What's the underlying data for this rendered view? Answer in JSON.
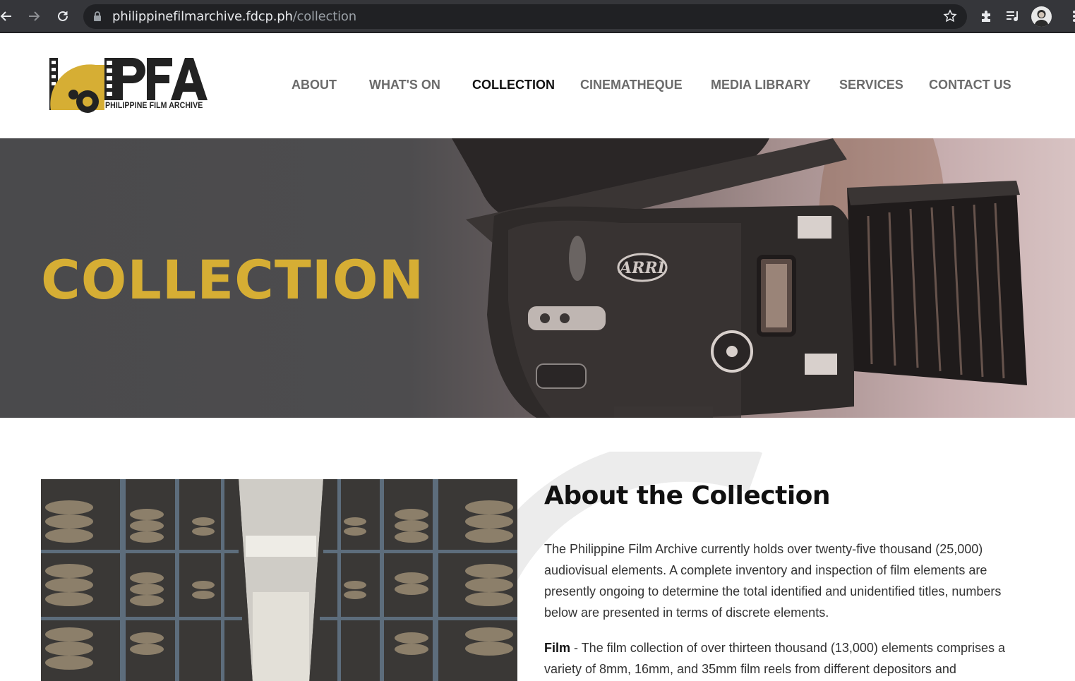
{
  "browser": {
    "url_host": "philippinefilmarchive.fdcp.ph",
    "url_path": "/collection"
  },
  "header": {
    "logo_text": "PFA",
    "logo_caption": "PHILIPPINE FILM ARCHIVE",
    "nav": [
      {
        "label": "ABOUT",
        "active": false
      },
      {
        "label": "WHAT'S ON",
        "active": false
      },
      {
        "label": "COLLECTION",
        "active": true
      },
      {
        "label": "CINEMATHEQUE",
        "active": false
      },
      {
        "label": "MEDIA LIBRARY",
        "active": false
      },
      {
        "label": "SERVICES",
        "active": false
      },
      {
        "label": "CONTACT US",
        "active": false
      }
    ]
  },
  "hero": {
    "title": "COLLECTION",
    "camera_badge": "ARRI"
  },
  "about": {
    "heading": "About the Collection",
    "paragraph1": "The Philippine Film Archive currently holds over twenty-five thousand (25,000) audiovisual elements. A complete inventory and inspection of film elements are presently ongoing to determine the total identified and unidentified titles, numbers below are presented in terms of discrete elements.",
    "film_label": "Film",
    "film_text": " - The film collection of over thirteen thousand (13,000) elements comprises a variety of 8mm, 16mm, and 35mm film reels from different depositors and"
  },
  "colors": {
    "accent_gold": "#d6ae34",
    "chrome_bg": "#35363a",
    "omnibox_bg": "#202124",
    "nav_text": "#6b6b6b",
    "nav_active": "#111111"
  },
  "icons": [
    "back-icon",
    "forward-icon",
    "reload-icon",
    "lock-icon",
    "star-icon",
    "extensions-icon",
    "media-queue-icon",
    "menu-dots-icon"
  ]
}
